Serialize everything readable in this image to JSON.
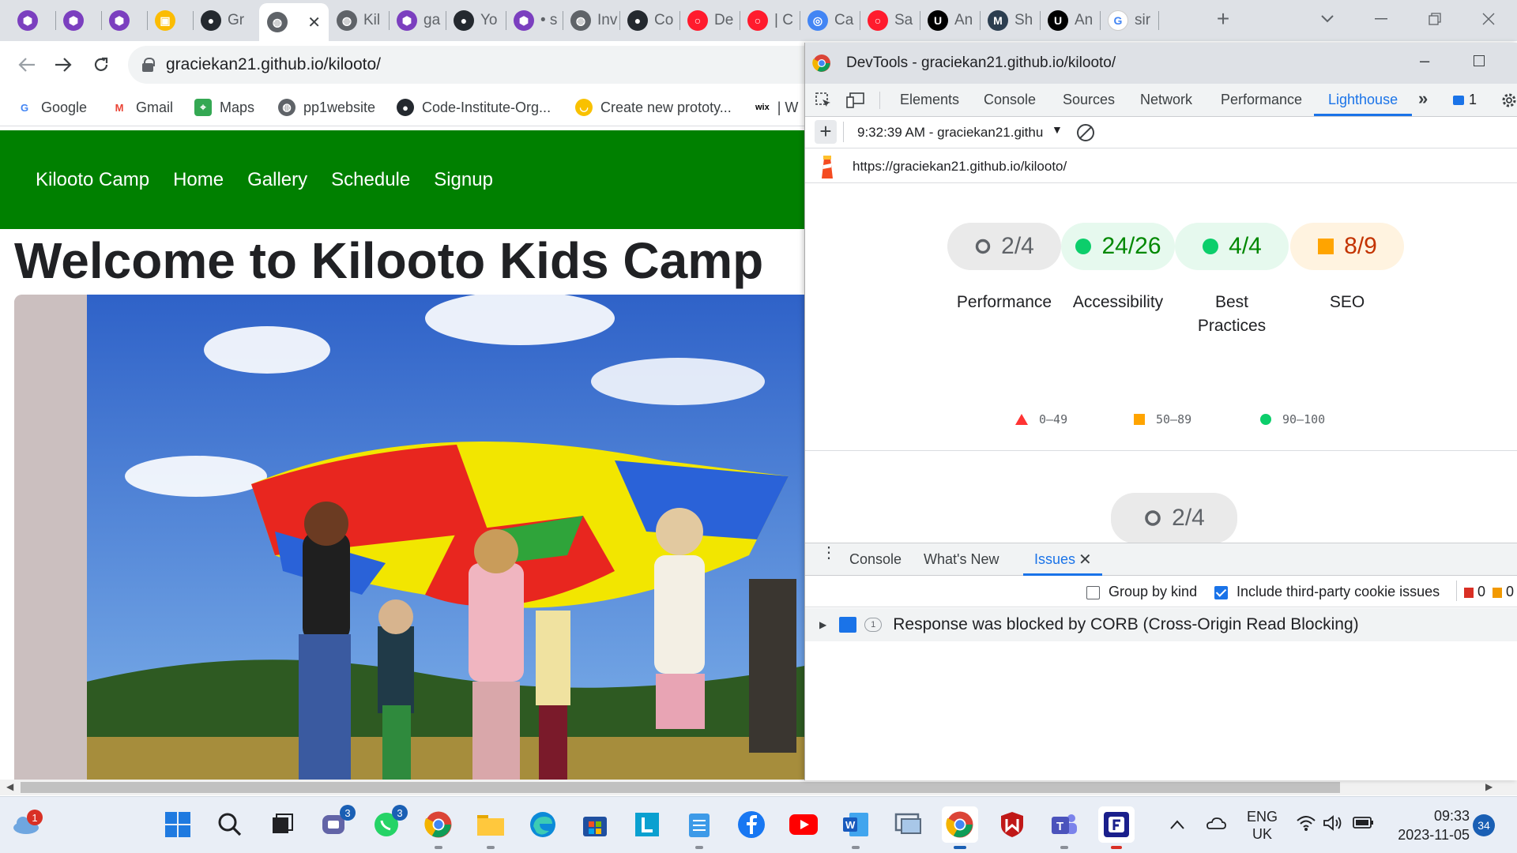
{
  "tabs": [
    {
      "label": "",
      "icon": "purple-hex-icon"
    },
    {
      "label": "",
      "icon": "purple-hex-icon"
    },
    {
      "label": "",
      "icon": "purple-hex-icon"
    },
    {
      "label": "",
      "icon": "google-meet-icon"
    },
    {
      "label": "Gr",
      "icon": "github-icon"
    },
    {
      "label": "",
      "icon": "globe-icon",
      "active": true
    },
    {
      "label": "Kil",
      "icon": "globe-icon"
    },
    {
      "label": "ga",
      "icon": "purple-hex-icon"
    },
    {
      "label": "Yo",
      "icon": "github-icon"
    },
    {
      "label": "• s",
      "icon": "purple-hex-icon"
    },
    {
      "label": "Inv",
      "icon": "globe-icon"
    },
    {
      "label": "Co",
      "icon": "github-icon"
    },
    {
      "label": "De",
      "icon": "opera-icon"
    },
    {
      "label": "| C",
      "icon": "opera-icon"
    },
    {
      "label": "Ca",
      "icon": "target-icon"
    },
    {
      "label": "Sa",
      "icon": "opera-icon"
    },
    {
      "label": "An",
      "icon": "udemy-icon"
    },
    {
      "label": "Sh",
      "icon": "maven-icon"
    },
    {
      "label": "An",
      "icon": "udemy-icon"
    },
    {
      "label": "sir",
      "icon": "google-icon"
    }
  ],
  "toolbar": {
    "url": "graciekan21.github.io/kilooto/"
  },
  "bookmarks": [
    {
      "label": "Google",
      "icon": "google-icon"
    },
    {
      "label": "Gmail",
      "icon": "gmail-icon"
    },
    {
      "label": "Maps",
      "icon": "maps-icon"
    },
    {
      "label": "pp1website",
      "icon": "globe-icon"
    },
    {
      "label": "Code-Institute-Org...",
      "icon": "github-icon"
    },
    {
      "label": "Create new prototy...",
      "icon": "smiley-icon"
    },
    {
      "label": "| W",
      "icon": "wix-icon"
    }
  ],
  "site": {
    "nav": [
      "Kilooto Camp",
      "Home",
      "Gallery",
      "Schedule",
      "Signup"
    ],
    "title": "Welcome to Kilooto Kids Camp",
    "nav_color": "#008000"
  },
  "devtools": {
    "window_title": "DevTools - graciekan21.github.io/kilooto/",
    "tabs": [
      "Elements",
      "Console",
      "Sources",
      "Network",
      "Performance",
      "Lighthouse"
    ],
    "active_tab": "Lighthouse",
    "issues_count": "1",
    "report_time": "9:32:39 AM - graciekan21.githu",
    "report_url": "https://graciekan21.github.io/kilooto/",
    "scores": [
      {
        "value": "2/4",
        "label": "Performance",
        "status": "neutral"
      },
      {
        "value": "24/26",
        "label": "Accessibility",
        "status": "pass"
      },
      {
        "value": "4/4",
        "label": "Best Practices",
        "status": "pass"
      },
      {
        "value": "8/9",
        "label": "SEO",
        "status": "average"
      }
    ],
    "legend": [
      {
        "range": "0–49",
        "shape": "triangle",
        "color": "#ff3333"
      },
      {
        "range": "50–89",
        "shape": "square",
        "color": "#ffa400"
      },
      {
        "range": "90–100",
        "shape": "circle",
        "color": "#0cce6b"
      }
    ],
    "detail_gauge": "2/4",
    "drawer_tabs": [
      "Console",
      "What's New",
      "Issues"
    ],
    "drawer_active": "Issues",
    "group_by_kind": "Group by kind",
    "include_third_party": "Include third-party cookie issues",
    "error_count": "0",
    "warning_count": "0",
    "issue_count_badge": "1",
    "issue_text": "Response was blocked by CORB (Cross-Origin Read Blocking)"
  },
  "taskbar": {
    "weather_badge": "1",
    "teams_badge": "3",
    "whatsapp_badge": "3",
    "lang": "ENG",
    "region": "UK",
    "time": "09:33",
    "date": "2023-11-05",
    "notif_count": "34"
  },
  "colors": {
    "pass": "#0cce6b",
    "average": "#ffa400",
    "fail": "#ff3333",
    "accent": "#1a73e8"
  }
}
